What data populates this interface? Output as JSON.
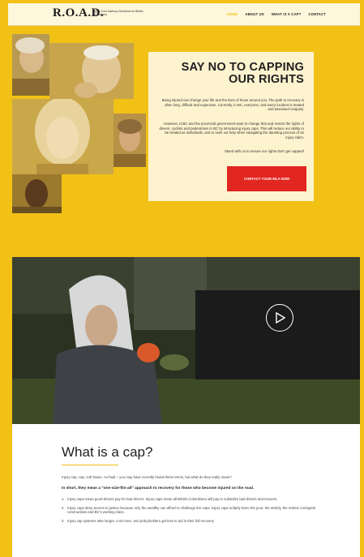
{
  "header": {
    "logo": "R.O.A.D.",
    "tagline": "Rights Over Advisory Decisions for British Columbians",
    "nav": [
      "HOME",
      "ABOUT US",
      "WHAT IS A CAP?",
      "CONTACT"
    ]
  },
  "hero": {
    "title": "SAY NO TO CAPPING OUR RIGHTS",
    "p1": "Being injured can change your life and the lives of those around you. The path to recovery is often long, difficult and expensive. Currently, in BC, everyone, and every incident is treated and assessed uniquely.",
    "p2": "However, ICBC and the provincial government want to change that and restrict the rights of drivers, cyclists and pedestrians in BC by introducing injury caps. This will reduce our ability to be treated as individuals, and to seek out help when navigating the daunting process of an injury claim.",
    "p3": "Stand with us to ensure our rights don't get capped!",
    "cta": "CONTACT YOUR MLA NOW"
  },
  "video": {
    "play_icon": "play-icon"
  },
  "cap": {
    "title": "What is a cap?",
    "intro": "Injury cap, cap, soft tissue, no-fault – you may have recently heard these terms, but what do they really mean?",
    "bold": "In short, they mean a \"one-size-fits-all\" approach to recovery for those who become injured on the road.",
    "items": [
      {
        "n": "1.",
        "text": "Injury caps mean good drivers pay for bad drivers. Injury caps mean all British Columbians will pay to subsidize bad drivers and insurers."
      },
      {
        "n": "2.",
        "text": "Injury caps deny access to justice because only the wealthy can afford to challenge the caps. Injury caps unfairly harm the poor, the elderly, the retired, immigrant communities and BC's working class."
      },
      {
        "n": "3.",
        "text": "Injury cap systems take longer, cost more, and policyholders get less to aid in their full recovery"
      }
    ]
  },
  "colors": {
    "accent": "#f2c116",
    "cta": "#e22620",
    "card": "#fdf3cf"
  }
}
